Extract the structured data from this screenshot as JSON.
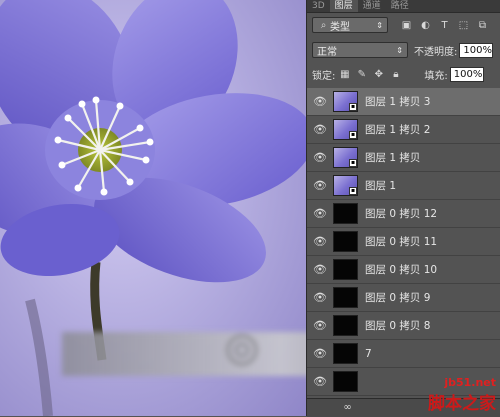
{
  "panel": {
    "tabs": [
      "3D",
      "图层",
      "通道",
      "路径"
    ],
    "active_tab": 1,
    "filter": {
      "label": "类型"
    },
    "blend_mode": "正常",
    "opacity": {
      "label": "不透明度:",
      "value": "100%"
    },
    "lock": {
      "label": "锁定:"
    },
    "fill": {
      "label": "填充:",
      "value": "100%"
    },
    "layers": [
      {
        "name": "图层 1 拷贝 3",
        "thumb": "image",
        "selected": true
      },
      {
        "name": "图层 1 拷贝 2",
        "thumb": "image",
        "selected": false
      },
      {
        "name": "图层 1 拷贝",
        "thumb": "image",
        "selected": false
      },
      {
        "name": "图层 1",
        "thumb": "image",
        "selected": false
      },
      {
        "name": "图层 0 拷贝 12",
        "thumb": "black",
        "selected": false
      },
      {
        "name": "图层 0 拷贝 11",
        "thumb": "black",
        "selected": false
      },
      {
        "name": "图层 0 拷贝 10",
        "thumb": "black",
        "selected": false
      },
      {
        "name": "图层 0 拷贝 9",
        "thumb": "black",
        "selected": false
      },
      {
        "name": "图层 0 拷贝 8",
        "thumb": "black",
        "selected": false
      },
      {
        "name": "7",
        "thumb": "black",
        "selected": false
      },
      {
        "name": "",
        "thumb": "black",
        "selected": false
      }
    ]
  },
  "watermark": {
    "url": "jb51.net",
    "name": "脚本之家"
  },
  "colors": {
    "panel_bg": "#535353",
    "selected_row": "#6d6d6d",
    "flower": "#7d73d6"
  }
}
